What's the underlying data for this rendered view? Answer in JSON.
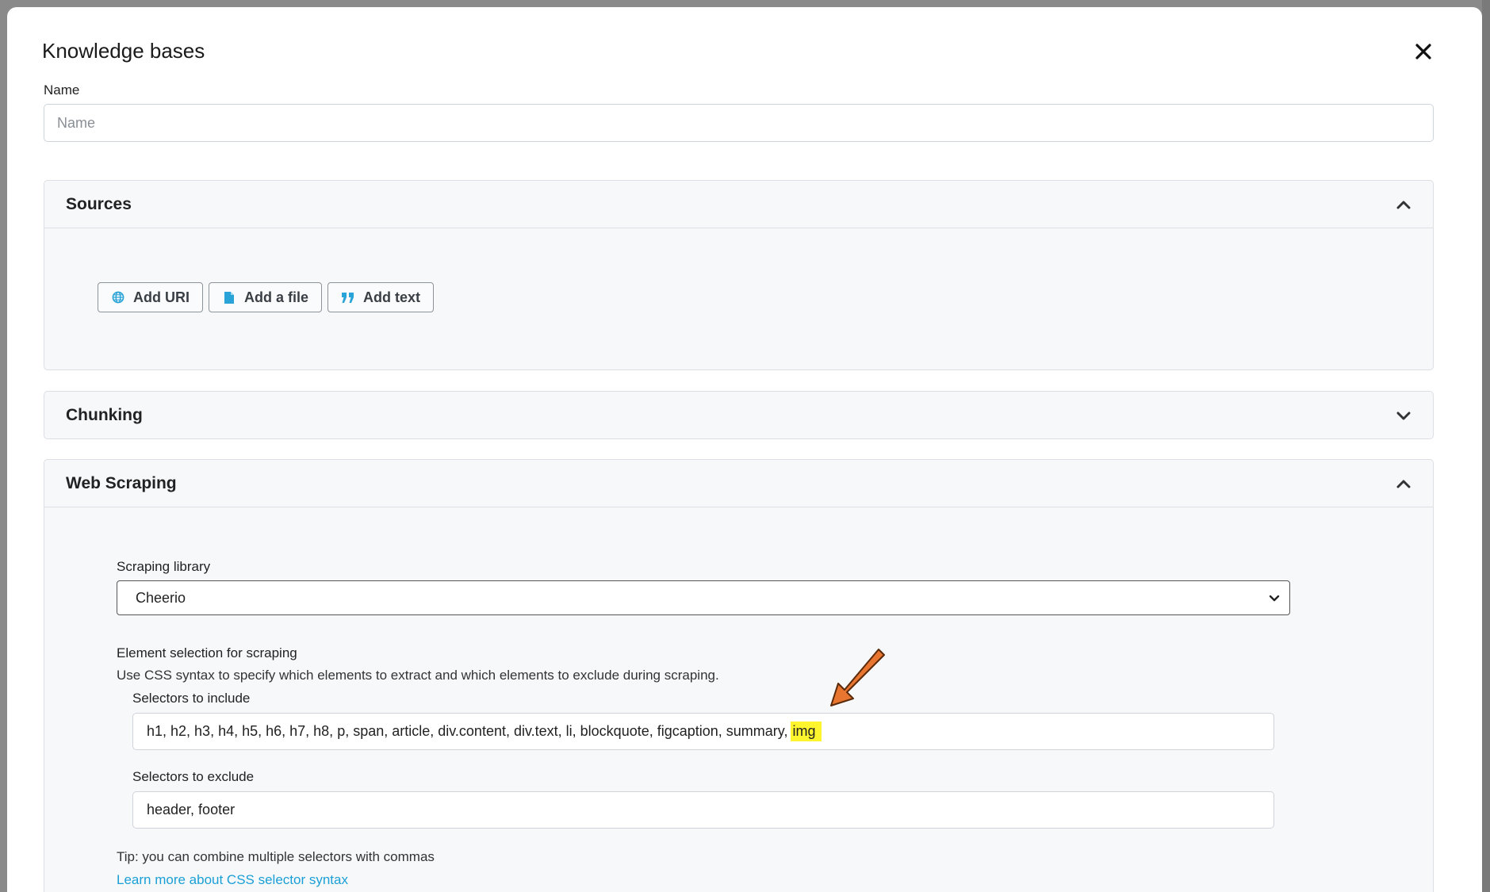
{
  "modal": {
    "title": "Knowledge bases",
    "close_icon": "close-icon"
  },
  "name_field": {
    "label": "Name",
    "placeholder": "Name",
    "value": ""
  },
  "sources": {
    "title": "Sources",
    "expanded": true,
    "buttons": [
      {
        "label": "Add URI",
        "icon": "globe-icon"
      },
      {
        "label": "Add a file",
        "icon": "file-icon"
      },
      {
        "label": "Add text",
        "icon": "quote-icon"
      }
    ]
  },
  "chunking": {
    "title": "Chunking",
    "expanded": false
  },
  "web_scraping": {
    "title": "Web Scraping",
    "expanded": true,
    "library_label": "Scraping library",
    "library_value": "Cheerio",
    "element_selection_label": "Element selection for scraping",
    "element_selection_desc": "Use CSS syntax to specify which elements to extract and which elements to exclude during scraping.",
    "include_label": "Selectors to include",
    "include_value": "h1, h2, h3, h4, h5, h6, h7, h8, p, span, article, div.content, div.text, li, blockquote, figcaption, summary,",
    "include_highlight": "img",
    "exclude_label": "Selectors to exclude",
    "exclude_value": "header, footer",
    "tip": "Tip: you can combine multiple selectors with commas",
    "learn_more": "Learn more about CSS selector syntax"
  },
  "colors": {
    "accent_link": "#1a9fd6",
    "highlight": "#fff52e",
    "annotation_arrow": "#e87530"
  }
}
